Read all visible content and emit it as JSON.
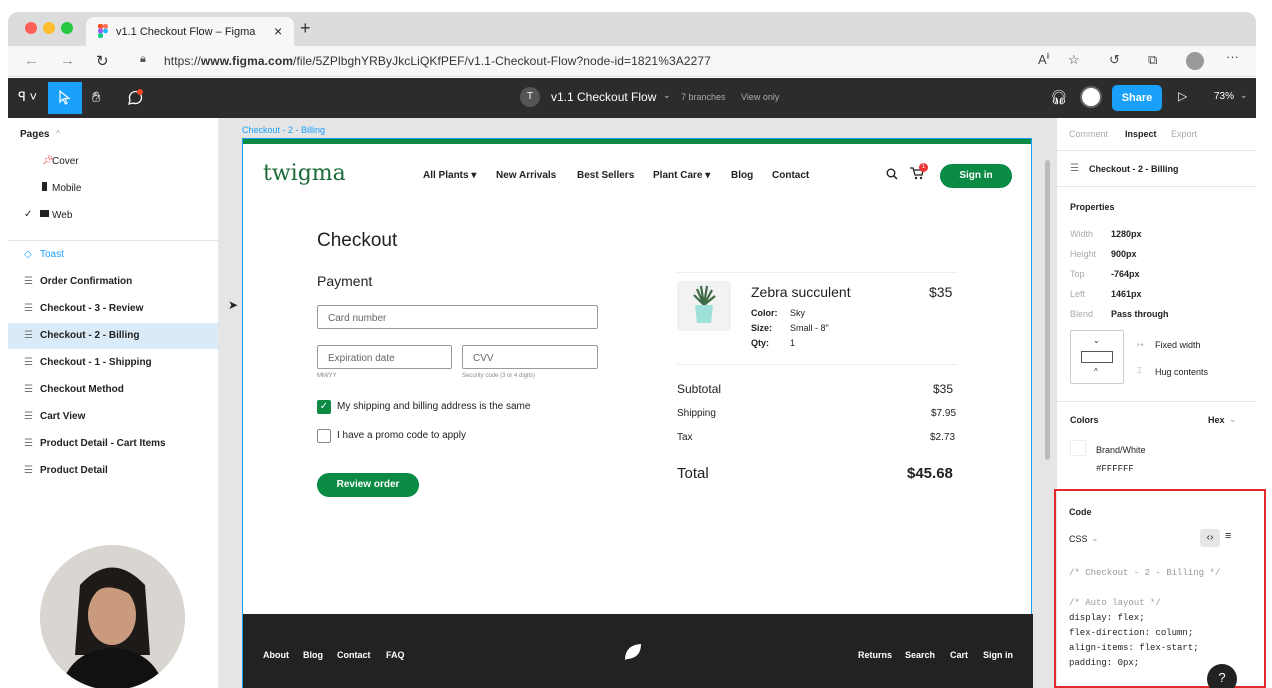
{
  "browser": {
    "tab_title": "v1.1 Checkout Flow – Figma",
    "url_prefix": "https://",
    "url_domain": "www.figma.com",
    "url_path": "/file/5ZPlbghYRByJkcLiQKfPEF/v1.1-Checkout-Flow?node-id=1821%3A2277",
    "new_tab_icon": "+"
  },
  "figma": {
    "file_initial": "T",
    "file_title": "v1.1 Checkout Flow",
    "branches": "7 branches",
    "mode": "View only",
    "share_label": "Share",
    "zoom": "73%"
  },
  "pages": {
    "header": "Pages",
    "items": [
      "Cover",
      "Mobile",
      "Web"
    ]
  },
  "layers": [
    "Toast",
    "Order Confirmation",
    "Checkout - 3 - Review",
    "Checkout - 2 - Billing",
    "Checkout - 1 - Shipping",
    "Checkout Method",
    "Cart View",
    "Product Detail - Cart Items",
    "Product Detail"
  ],
  "frame": {
    "label": "Checkout - 2 - Billing",
    "logo": "twigma",
    "nav": [
      "All Plants",
      "New Arrivals",
      "Best Sellers",
      "Plant Care",
      "Blog",
      "Contact"
    ],
    "signin": "Sign in",
    "cart_count": "1",
    "heading": "Checkout",
    "payment": "Payment",
    "card_placeholder": "Card number",
    "exp_placeholder": "Expiration date",
    "exp_hint": "MM/YY",
    "cvv_placeholder": "CVV",
    "cvv_hint": "Security code (3 or 4 digits)",
    "same_address": "My shipping and billing address is the same",
    "promo": "I have a promo code to apply",
    "review_btn": "Review order",
    "product": {
      "name": "Zebra succulent",
      "price": "$35",
      "color_label": "Color:",
      "color": "Sky",
      "size_label": "Size:",
      "size": "Small - 8\"",
      "qty_label": "Qty:",
      "qty": "1"
    },
    "summary": {
      "subtotal_label": "Subtotal",
      "subtotal": "$35",
      "shipping_label": "Shipping",
      "shipping": "$7.95",
      "tax_label": "Tax",
      "tax": "$2.73",
      "total_label": "Total",
      "total": "$45.68"
    },
    "footer_left": [
      "About",
      "Blog",
      "Contact",
      "FAQ"
    ],
    "footer_right": [
      "Returns",
      "Search",
      "Cart",
      "Sign in"
    ]
  },
  "inspect": {
    "tabs": [
      "Comment",
      "Inspect",
      "Export"
    ],
    "selected": "Checkout - 2 - Billing",
    "properties_label": "Properties",
    "props": [
      {
        "label": "Width",
        "value": "1280px"
      },
      {
        "label": "Height",
        "value": "900px"
      },
      {
        "label": "Top",
        "value": "-764px"
      },
      {
        "label": "Left",
        "value": "1461px"
      },
      {
        "label": "Blend",
        "value": "Pass through"
      }
    ],
    "fixed_width": "Fixed width",
    "hug_contents": "Hug contents",
    "colors_label": "Colors",
    "color_format": "Hex",
    "color_name": "Brand/White",
    "color_hex": "#FFFFFF",
    "code_label": "Code",
    "code_lang": "CSS",
    "code_lines": [
      "/* Checkout - 2 - Billing */",
      "",
      "/* Auto layout */",
      "display: flex;",
      "flex-direction: column;",
      "align-items: flex-start;",
      "padding: 0px;"
    ],
    "help": "?"
  },
  "colors": {
    "brand_green": "#0a8a43",
    "figma_blue": "#18a0fb",
    "highlight_red": "#e32a2a"
  }
}
